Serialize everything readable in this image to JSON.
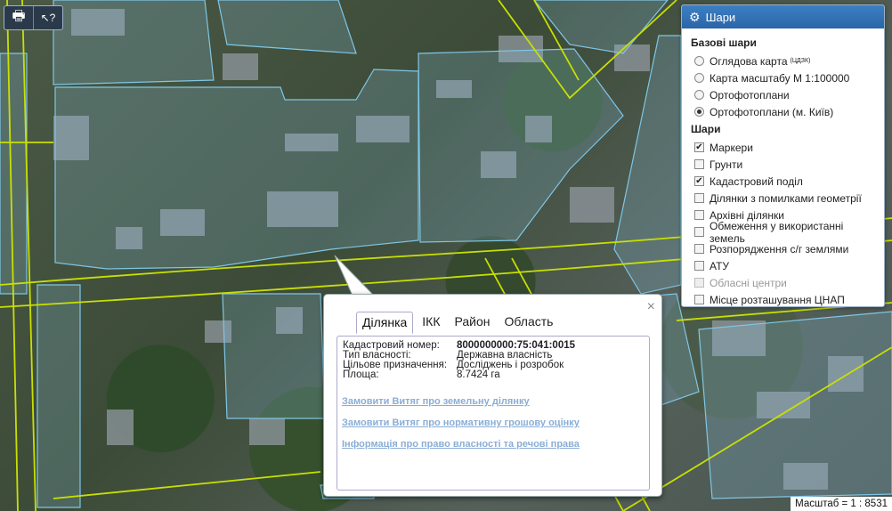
{
  "map": {
    "tools": [
      {
        "name": "print-icon",
        "glyph": "🖶"
      },
      {
        "name": "identify-help-icon",
        "glyph": "↖?"
      }
    ],
    "scale_text": "Масштаб = 1 : 8531"
  },
  "layers": {
    "title": "Шари",
    "base_title": "Базові шари",
    "base_layers": [
      {
        "label": "Оглядова карта",
        "sup": "(ЦДЗК)",
        "selected": false
      },
      {
        "label": "Карта масштабу М 1:100000",
        "sup": "",
        "selected": false
      },
      {
        "label": "Ортофотоплани",
        "sup": "",
        "selected": false
      },
      {
        "label": "Ортофотоплани (м. Київ)",
        "sup": "",
        "selected": true
      }
    ],
    "overlay_title": "Шари",
    "overlays": [
      {
        "label": "Маркери",
        "checked": true,
        "disabled": false
      },
      {
        "label": "Грунти",
        "checked": false,
        "disabled": false
      },
      {
        "label": "Кадастровий поділ",
        "checked": true,
        "disabled": false
      },
      {
        "label": "Ділянки з помилками геометрії",
        "checked": false,
        "disabled": false
      },
      {
        "label": "Архівні ділянки",
        "checked": false,
        "disabled": false
      },
      {
        "label": "Обмеження у використанні земель",
        "checked": false,
        "disabled": false
      },
      {
        "label": "Розпорядження с/г землями",
        "checked": false,
        "disabled": false
      },
      {
        "label": "АТУ",
        "checked": false,
        "disabled": false
      },
      {
        "label": "Обласні центри",
        "checked": false,
        "disabled": true
      },
      {
        "label": "Місце розташування ЦНАП",
        "checked": false,
        "disabled": false
      }
    ]
  },
  "popup": {
    "close": "×",
    "tabs": [
      "Ділянка",
      "ІКК",
      "Район",
      "Область"
    ],
    "active_tab": 0,
    "fields": [
      {
        "key": "Кадастровий номер:",
        "value": "8000000000:75:041:0015"
      },
      {
        "key": "Тип власності:",
        "value": "Державна власність"
      },
      {
        "key": "Цільове призначення:",
        "value": "Досліджень і розробок"
      },
      {
        "key": "Площа:",
        "value": "8.7424 га"
      }
    ],
    "links": [
      "Замовити Витяг про земельну ділянку",
      "Замовити Витяг про нормативну грошову оцінку",
      "Інформація про право власності та речові права"
    ]
  },
  "colors": {
    "road_outline": "#c8e000",
    "parcel_outline": "#7fc6e6",
    "panel_header": "#2a66a8",
    "link": "#8aaed6"
  }
}
